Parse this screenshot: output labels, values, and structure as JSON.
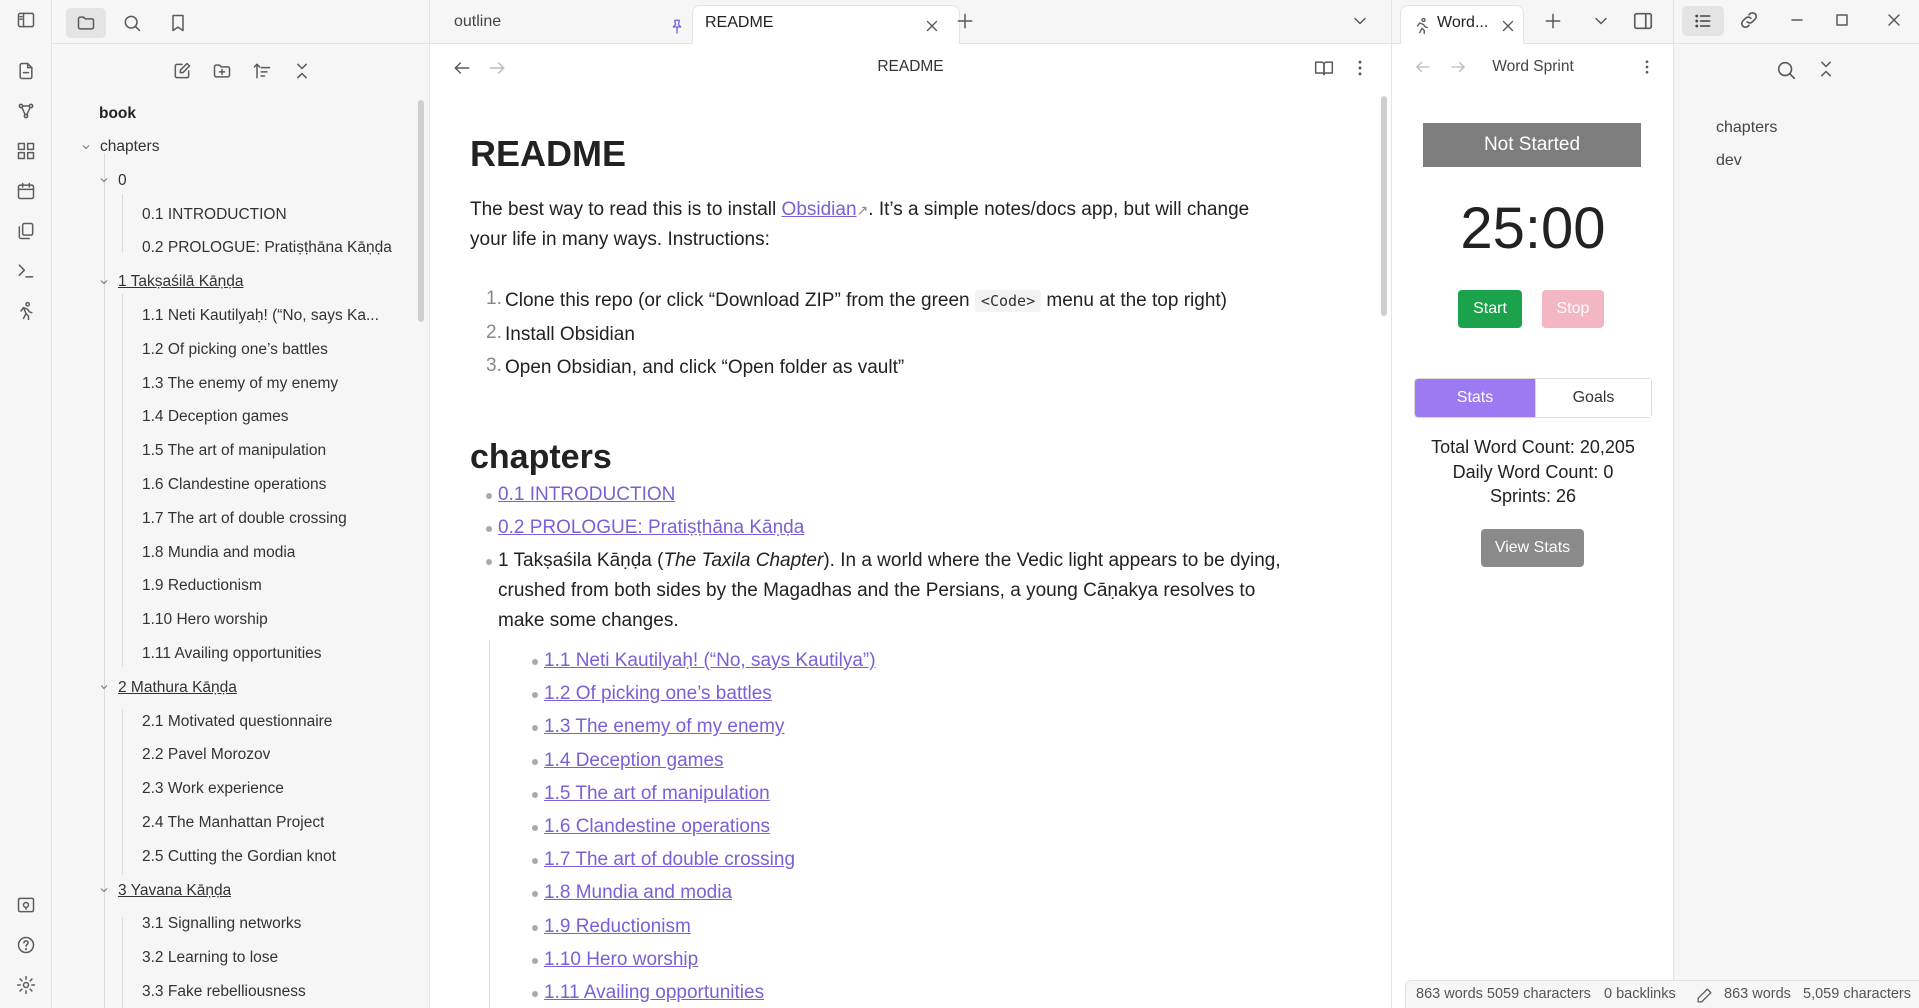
{
  "ribbon": {
    "icons": [
      "open-quick-switcher-icon",
      "graph-view-icon",
      "canvas-icon",
      "daily-note-icon",
      "templates-icon",
      "command-palette-icon",
      "word-sprint-icon",
      "vault-switcher-icon",
      "help-icon",
      "settings-icon"
    ]
  },
  "explorer": {
    "top_icons": [
      "files-icon",
      "search-icon",
      "bookmark-icon"
    ],
    "tools": [
      "new-note-icon",
      "new-folder-icon",
      "sort-icon",
      "collapse-all-icon"
    ],
    "root": "book",
    "tree": [
      {
        "label": "chapters",
        "level": 1,
        "folder": true
      },
      {
        "label": "0",
        "level": 2,
        "folder": true
      },
      {
        "label": "0.1 INTRODUCTION",
        "level": 3
      },
      {
        "label": "0.2 PROLOGUE: Pratiṣṭhāna Kāṇḍa",
        "level": 3
      },
      {
        "label": "1 Takṣaśilā Kāṇḍa",
        "level": 2,
        "folder": true
      },
      {
        "label": "1.1 Neti Kautilyaḥ! (“No, says Ka...",
        "level": 3
      },
      {
        "label": "1.2 Of picking one’s battles",
        "level": 3
      },
      {
        "label": "1.3 The enemy of my enemy",
        "level": 3
      },
      {
        "label": "1.4 Deception games",
        "level": 3
      },
      {
        "label": "1.5 The art of manipulation",
        "level": 3
      },
      {
        "label": "1.6 Clandestine operations",
        "level": 3
      },
      {
        "label": "1.7 The art of double crossing",
        "level": 3
      },
      {
        "label": "1.8 Mundia and modia",
        "level": 3
      },
      {
        "label": "1.9 Reductionism",
        "level": 3
      },
      {
        "label": "1.10 Hero worship",
        "level": 3
      },
      {
        "label": "1.11 Availing opportunities",
        "level": 3
      },
      {
        "label": "2 Mathura Kāṇḍa",
        "level": 2,
        "folder": true
      },
      {
        "label": "2.1 Motivated questionnaire",
        "level": 3
      },
      {
        "label": "2.2 Pavel Morozov",
        "level": 3
      },
      {
        "label": "2.3 Work experience",
        "level": 3
      },
      {
        "label": "2.4 The Manhattan Project",
        "level": 3
      },
      {
        "label": "2.5 Cutting the Gordian knot",
        "level": 3
      },
      {
        "label": "3 Yavana Kāṇḍa",
        "level": 2,
        "folder": true
      },
      {
        "label": "3.1 Signalling networks",
        "level": 3
      },
      {
        "label": "3.2 Learning to lose",
        "level": 3
      },
      {
        "label": "3.3 Fake rebelliousness",
        "level": 3
      }
    ]
  },
  "tabs": {
    "outline": "outline",
    "readme": "README",
    "new_tab": "+"
  },
  "view": {
    "title": "README"
  },
  "doc": {
    "h1": "README",
    "intro_before": "The best way to read this is to install ",
    "intro_link": "Obsidian",
    "intro_after_line1": ". It’s a simple notes/docs app, but will change",
    "intro_line2": "your life in many ways. Instructions:",
    "steps": [
      {
        "num": "1.",
        "before": "Clone this repo (or click “Download ZIP” from the green ",
        "code": "<Code>",
        "after": " menu at the top right)"
      },
      {
        "num": "2.",
        "text": "Install Obsidian"
      },
      {
        "num": "3.",
        "text": "Open Obsidian, and click “Open folder as vault”"
      }
    ],
    "h2": "chapters",
    "top_links": [
      "0.1 INTRODUCTION",
      "0.2 PROLOGUE: Pratiṣṭhāna Kāṇḍa"
    ],
    "chapter1_prefix": "1 Takṣaśila Kāṇḍa (",
    "chapter1_italic": "The Taxila Chapter",
    "chapter1_line1_rest": "). In a world where the Vedic light appears to be dying,",
    "chapter1_line2": "crushed from both sides by the Magadhas and the Persians, a young Cāṇakya resolves to",
    "chapter1_line3": "make some changes.",
    "sub_links": [
      "1.1 Neti Kautilyaḥ! (“No, says Kautilya”)",
      "1.2 Of picking one’s battles",
      "1.3 The enemy of my enemy",
      "1.4 Deception games",
      "1.5 The art of manipulation",
      "1.6 Clandestine operations",
      "1.7 The art of double crossing",
      "1.8 Mundia and modia",
      "1.9 Reductionism",
      "1.10 Hero worship",
      "1.11 Availing opportunities"
    ]
  },
  "sprint": {
    "tab_label": "Word...",
    "title": "Word Sprint",
    "status": "Not Started",
    "timer": "25:00",
    "start": "Start",
    "stop": "Stop",
    "tab_stats": "Stats",
    "tab_goals": "Goals",
    "total": "Total Word Count: 20,205",
    "daily": "Daily Word Count: 0",
    "sprints": "Sprints: 26",
    "view_stats": "View Stats"
  },
  "outline_pane": {
    "items": [
      "chapters",
      "dev"
    ]
  },
  "statusbar": {
    "words_chars": "863 words 5059 characters",
    "backlinks": "0 backlinks",
    "words": "863 words",
    "characters": "5,059 characters"
  },
  "colors": {
    "accent": "#7a5fd6",
    "start_green": "#1aa34a",
    "stop_pink": "#f4b6c2",
    "stats_purple": "#9c7af2"
  }
}
